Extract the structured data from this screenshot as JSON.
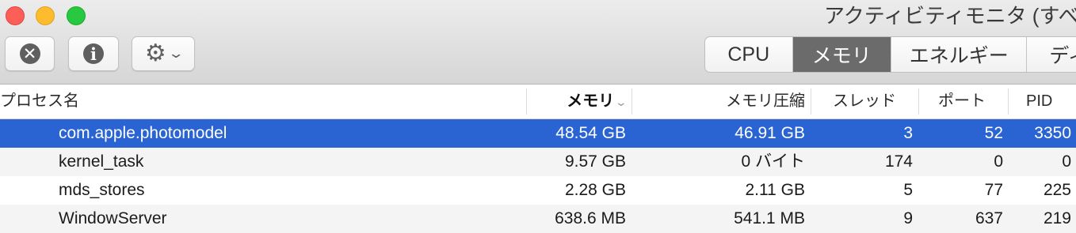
{
  "window": {
    "title": "アクティビティモニタ (すべて"
  },
  "toolbar": {
    "stop_process_icon": "✕",
    "info_icon": "i",
    "gear_icon": "⚙",
    "chevron_icon": "⌄"
  },
  "tabs": [
    {
      "label": "CPU",
      "active": false
    },
    {
      "label": "メモリ",
      "active": true
    },
    {
      "label": "エネルギー",
      "active": false
    },
    {
      "label": "ディ",
      "active": false
    }
  ],
  "columns": {
    "name": "プロセス名",
    "memory": "メモリ",
    "memory_sort_icon": "⌄",
    "compressed": "メモリ圧縮",
    "threads": "スレッド",
    "ports": "ポート",
    "pid": "PID"
  },
  "rows": [
    {
      "name": "com.apple.photomodel",
      "memory": "48.54 GB",
      "compressed": "46.91 GB",
      "threads": "3",
      "ports": "52",
      "pid": "3350"
    },
    {
      "name": "kernel_task",
      "memory": "9.57 GB",
      "compressed": "0 バイト",
      "threads": "174",
      "ports": "0",
      "pid": "0"
    },
    {
      "name": "mds_stores",
      "memory": "2.28 GB",
      "compressed": "2.11 GB",
      "threads": "5",
      "ports": "77",
      "pid": "225"
    },
    {
      "name": "WindowServer",
      "memory": "638.6 MB",
      "compressed": "541.1 MB",
      "threads": "9",
      "ports": "637",
      "pid": "219"
    }
  ],
  "colors": {
    "selection": "#2a64d2",
    "active_tab": "#6b6b6b"
  }
}
